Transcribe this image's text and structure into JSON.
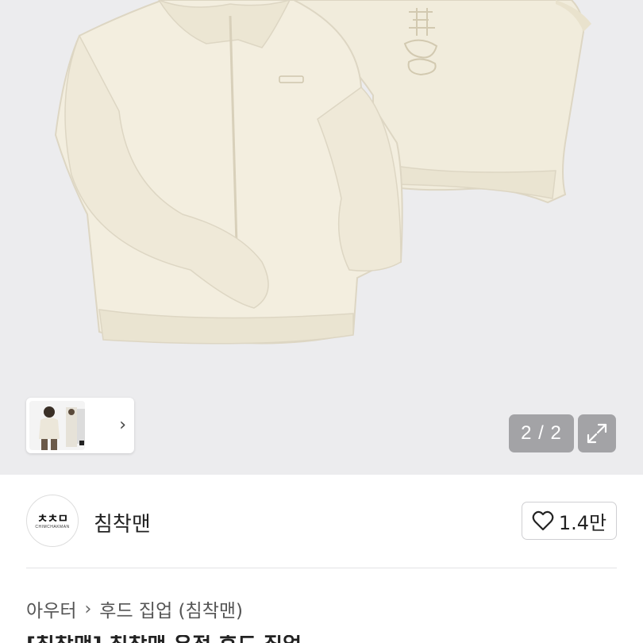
{
  "gallery": {
    "current_page": "2 / 2",
    "thumb_next_icon": "chevron-right-icon",
    "expand_icon": "expand-arrows-icon",
    "background_color": "#ececee",
    "product_color": "#f1ecdc"
  },
  "shop": {
    "logo_mark": "ㅊㅊㅁ",
    "logo_subtext": "CHIMCHAKMAN",
    "name": "침착맨",
    "like_icon": "heart-outline-icon",
    "like_count": "1.4만"
  },
  "breadcrumb": {
    "category": "아우터",
    "separator": "›",
    "subcategory": "후드 집업 (침착맨)"
  },
  "product": {
    "title": "[침착맨] 침착맨 우정 후드 집업"
  }
}
